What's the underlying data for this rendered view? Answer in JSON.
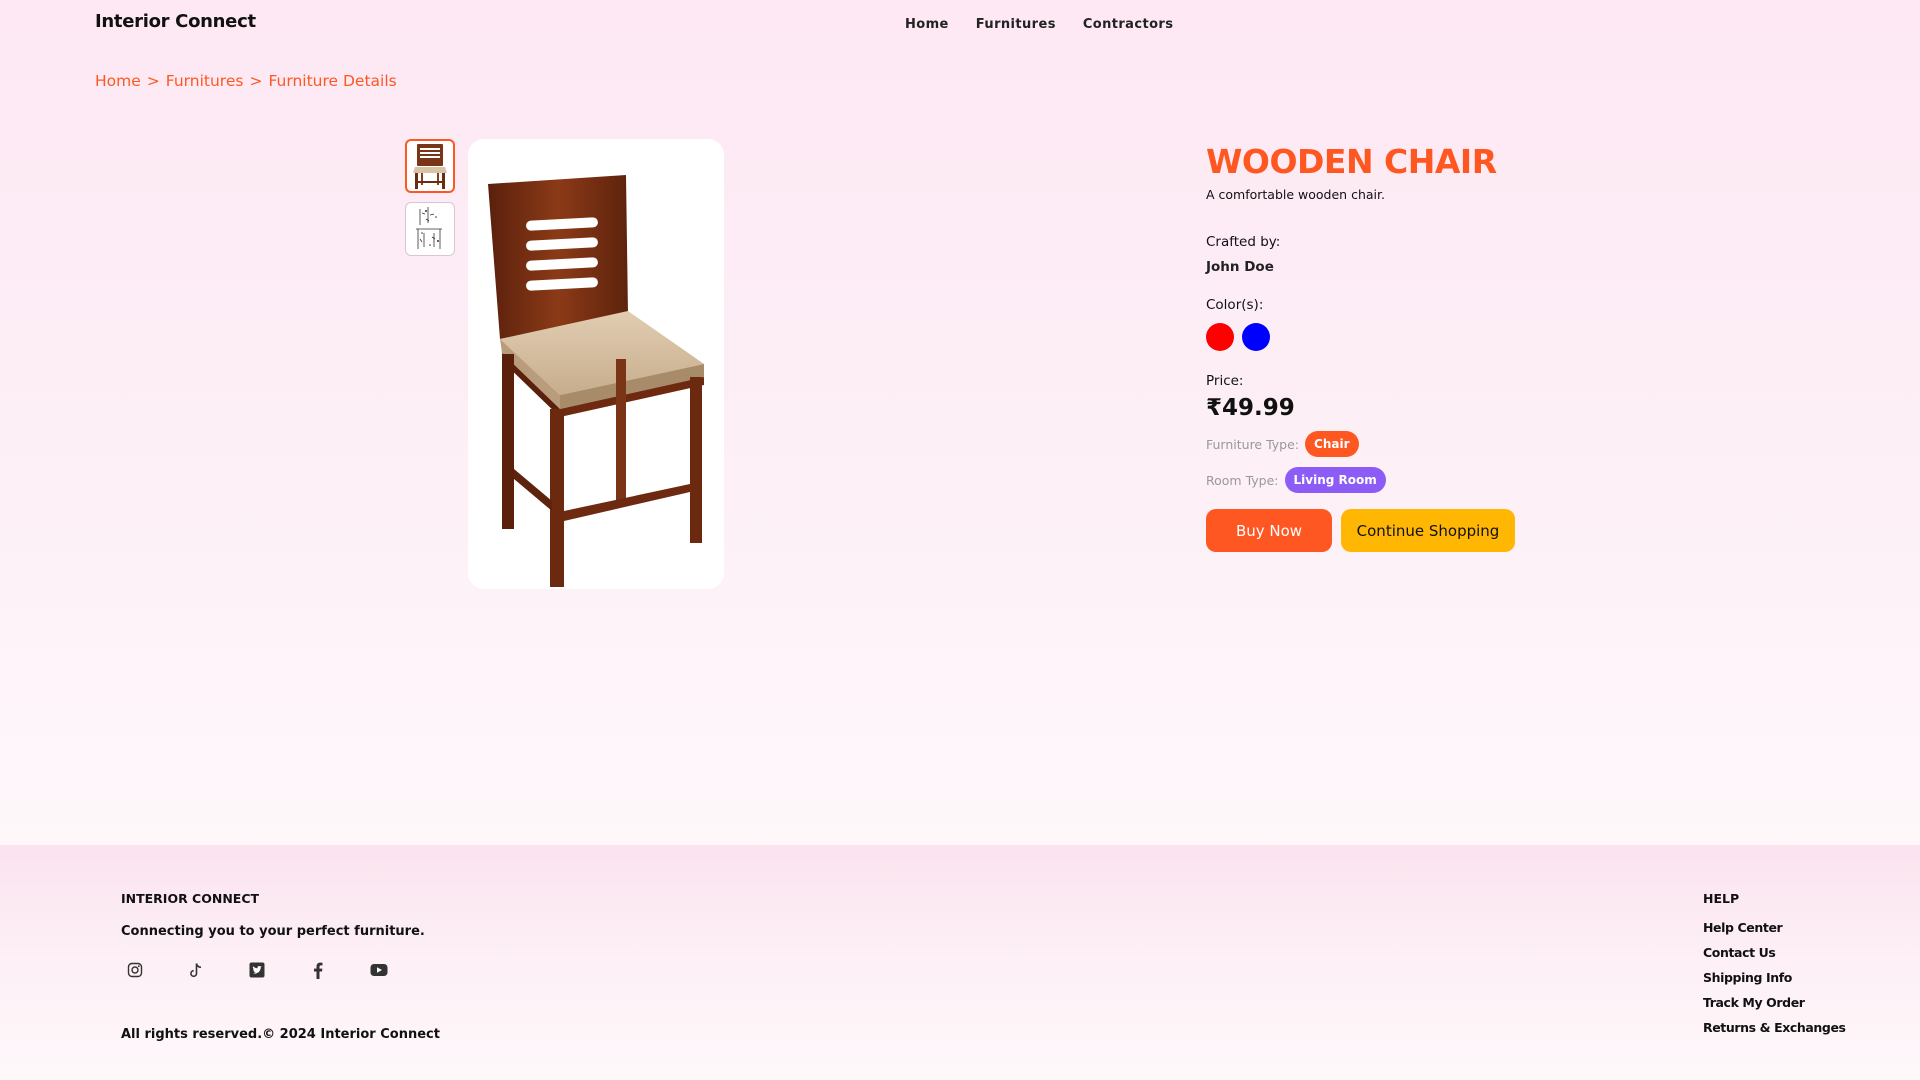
{
  "header": {
    "brand": "Interior Connect",
    "nav": [
      "Home",
      "Furnitures",
      "Contractors"
    ]
  },
  "breadcrumb": {
    "items": [
      "Home",
      "Furnitures",
      "Furniture Details"
    ],
    "separator": ">"
  },
  "product": {
    "title": "WOODEN CHAIR",
    "description": "A comfortable wooden chair.",
    "crafted_label": "Crafted by:",
    "crafter": "John Doe",
    "colors_label": "Color(s):",
    "colors": [
      "#ff0000",
      "#0000ff"
    ],
    "price_label": "Price:",
    "price": "₹49.99",
    "furniture_type_label": "Furniture Type:",
    "furniture_type": "Chair",
    "room_type_label": "Room Type:",
    "room_type": "Living Room",
    "buy_label": "Buy Now",
    "continue_label": "Continue Shopping"
  },
  "footer": {
    "brand": "INTERIOR CONNECT",
    "tagline": "Connecting you to your perfect furniture.",
    "socials": [
      "instagram-icon",
      "tiktok-icon",
      "twitter-icon",
      "facebook-icon",
      "youtube-icon"
    ],
    "copyright": "All rights reserved.© 2024 Interior Connect",
    "help_title": "HELP",
    "help_links": [
      "Help Center",
      "Contact Us",
      "Shipping Info",
      "Track My Order",
      "Returns & Exchanges"
    ]
  },
  "colors": {
    "accent": "#ff5722",
    "secondary": "#ffb703",
    "purple": "#8b5cf6"
  }
}
